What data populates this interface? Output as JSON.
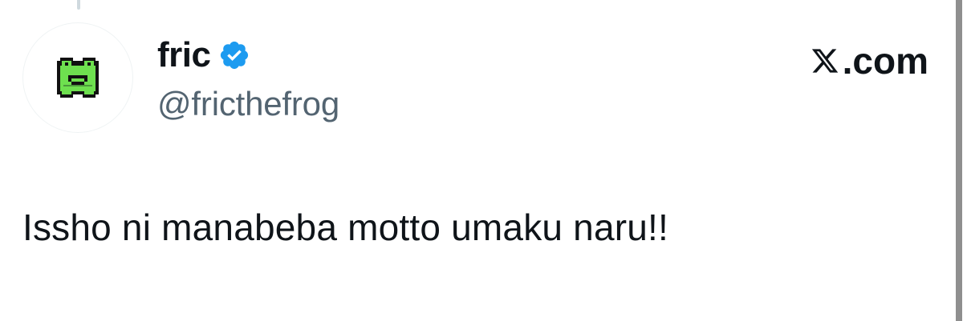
{
  "post": {
    "author": {
      "display_name": "fric",
      "handle": "@fricthefrog",
      "verified": true,
      "avatar_icon": "frog-icon",
      "verified_icon": "verified-badge-icon"
    },
    "brand": {
      "logo_icon": "x-logo-icon",
      "domain": ".com"
    },
    "text": "Issho ni manabeba motto umaku naru!!"
  },
  "colors": {
    "text_primary": "#0f1419",
    "text_secondary": "#536471",
    "verified_blue": "#1d9bf0",
    "frog_green": "#6ee04f",
    "background": "#ffffff"
  }
}
